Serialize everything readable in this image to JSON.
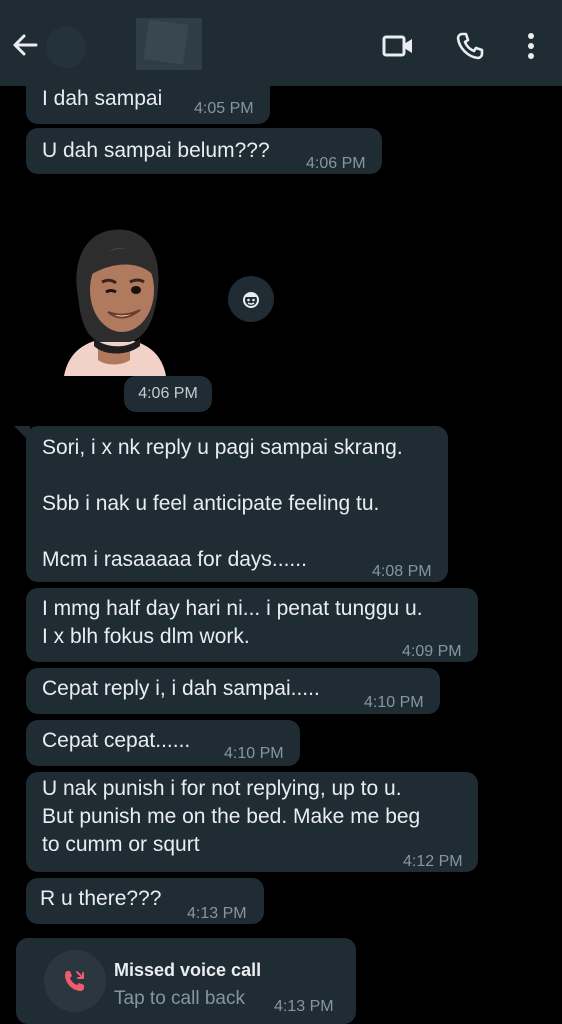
{
  "header": {
    "back_icon": "arrow-left-icon",
    "video_icon": "video-camera-icon",
    "call_icon": "phone-icon",
    "menu_icon": "more-vertical-icon"
  },
  "messages": [
    {
      "text": "I dah sampai",
      "time": "4:05 PM"
    },
    {
      "text": "U dah sampai belum???",
      "time": "4:06 PM"
    },
    {
      "text": "Sori, i x nk reply u pagi sampai skrang.\n\nSbb i nak u feel anticipate feeling tu.\n\nMcm i rasaaaaa for days......",
      "time": "4:08 PM"
    },
    {
      "text": "I mmg half day hari ni... i penat tunggu u.\nI x blh fokus dlm work.",
      "time": "4:09 PM"
    },
    {
      "text": "Cepat reply i, i dah sampai.....",
      "time": "4:10 PM"
    },
    {
      "text": "Cepat cepat......",
      "time": "4:10 PM"
    },
    {
      "text": "U nak punish i for not replying, up to u.\nBut punish me on the bed. Make me beg\nto cumm or squrt",
      "time": "4:12 PM"
    },
    {
      "text": "R u there???",
      "time": "4:13 PM"
    }
  ],
  "sticker": {
    "time": "4:06 PM",
    "reaction_icon": "avatar-emoji-icon"
  },
  "missed_call": {
    "title": "Missed voice call",
    "subtitle": "Tap to call back",
    "time": "4:13 PM",
    "icon": "missed-call-icon"
  },
  "colors": {
    "background": "#000000",
    "header": "#1f2c34",
    "bubble": "#1f2c34",
    "text": "#e9edef",
    "meta": "#8696a0",
    "missed": "#f15c6d"
  }
}
